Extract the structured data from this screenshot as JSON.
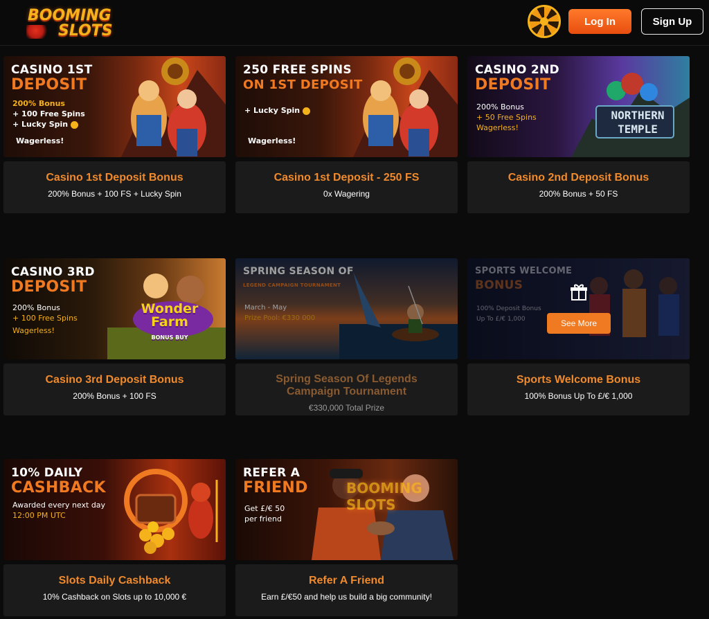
{
  "header": {
    "logo_line1": "BOOMING",
    "logo_line2": "SLOTS",
    "login_label": "Log In",
    "signup_label": "Sign Up"
  },
  "promos": [
    {
      "title": "Casino 1st Deposit Bonus",
      "subtitle": "200% Bonus + 100 FS + Lucky Spin",
      "banner": {
        "heading1": "CASINO 1ST",
        "heading2": "DEPOSIT",
        "line1": "200% Bonus",
        "line2": "+ 100 Free Spins",
        "line3": "+ Lucky Spin",
        "tag": "Wagerless!"
      }
    },
    {
      "title": "Casino 1st Deposit - 250 FS",
      "subtitle": "0x Wagering",
      "banner": {
        "heading1": "250 FREE SPINS",
        "heading2": "ON 1ST DEPOSIT",
        "line1": "+ Lucky Spin",
        "tag": "Wagerless!"
      }
    },
    {
      "title": "Casino 2nd Deposit Bonus",
      "subtitle": "200% Bonus + 50 FS",
      "banner": {
        "heading1": "CASINO 2ND",
        "heading2": "DEPOSIT",
        "line1": "200% Bonus",
        "line2": "+ 50 Free Spins",
        "tag": "Wagerless!",
        "game1": "NORTHERN",
        "game2": "TEMPLE"
      }
    },
    {
      "title": "Casino 3rd Deposit Bonus",
      "subtitle": "200% Bonus + 100 FS",
      "banner": {
        "heading1": "CASINO 3RD",
        "heading2": "DEPOSIT",
        "line1": "200% Bonus",
        "line2": "+ 100 Free Spins",
        "tag": "Wagerless!",
        "game1": "Wonder",
        "game2": "Farm",
        "game3": "BONUS BUY"
      }
    },
    {
      "title": "Spring Season Of Legends Campaign Tournament",
      "subtitle": "€330,000 Total Prize",
      "banner": {
        "heading1": "SPRING SEASON OF",
        "heading2": "LEGEND CAMPAIGN TOURNAMENT",
        "line1": "March - May",
        "line2": "Prize Pool: €330 000"
      }
    },
    {
      "title": "Sports Welcome Bonus",
      "subtitle": "100% Bonus Up To £/€ 1,000",
      "banner": {
        "heading1": "SPORTS WELCOME",
        "heading2": "BONUS",
        "line1": "100% Deposit Bonus",
        "line2": "Up To £/€ 1,000",
        "cta": "See More"
      }
    },
    {
      "title": "Slots Daily Cashback",
      "subtitle": "10% Cashback on Slots up to 10,000 €",
      "banner": {
        "heading1": "10% DAILY",
        "heading2": "CASHBACK",
        "line1": "Awarded every next day",
        "line2": "12:00 PM UTC"
      }
    },
    {
      "title": "Refer A Friend",
      "subtitle": "Earn £/€50 and help us build a big community!",
      "banner": {
        "heading1": "REFER A",
        "heading2": "FRIEND",
        "line1": "Get £/€ 50",
        "line2": "per friend",
        "sign": "BOOMING SLOTS"
      }
    }
  ],
  "colors": {
    "accent": "#f07a21",
    "card_bg": "#1b1b1b",
    "page_bg": "#0b0b0b"
  },
  "icons": [
    "wheel-of-fortune-icon",
    "gift-icon",
    "lucky-spin-icon"
  ]
}
